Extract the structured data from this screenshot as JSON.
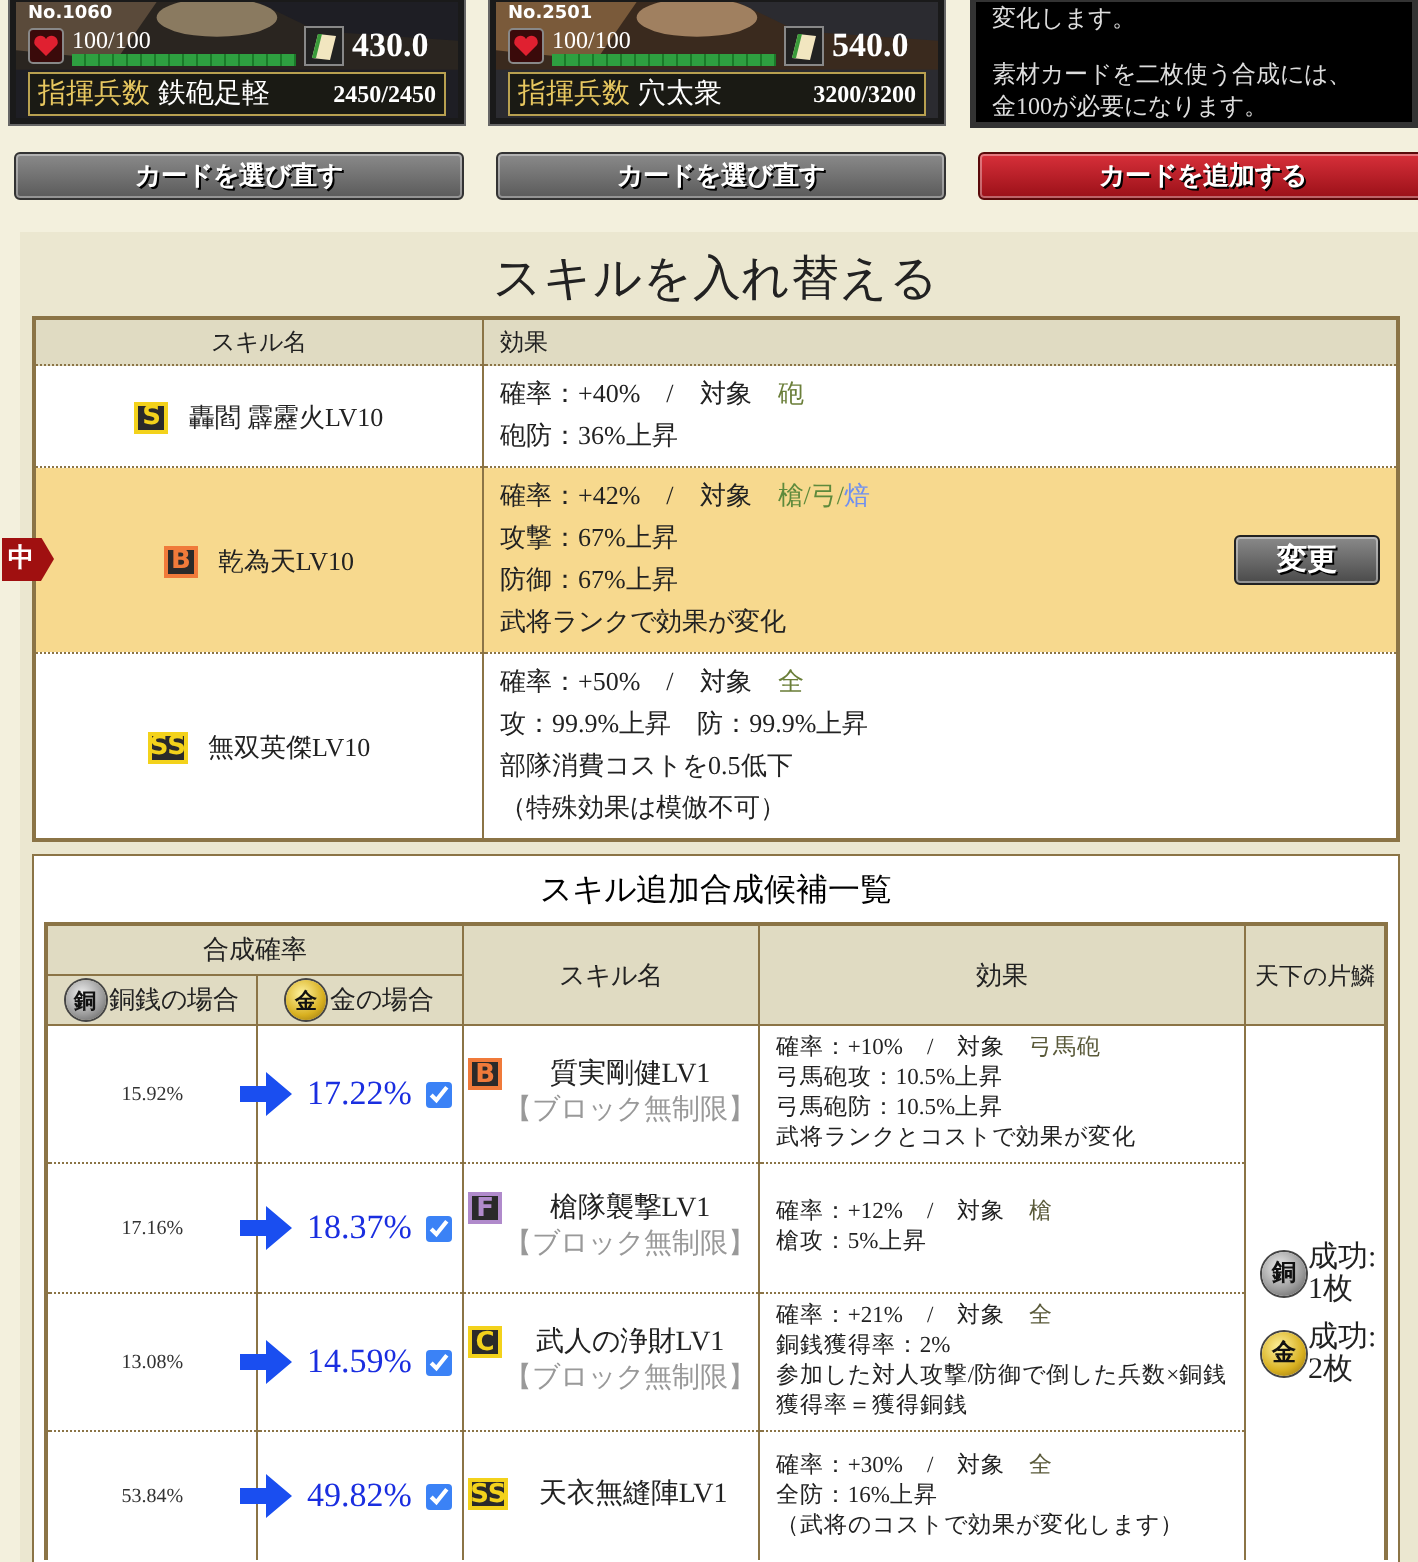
{
  "cards": [
    {
      "number": "No.1060",
      "hp": "100/100",
      "hp_bar": {
        "level": 1
      },
      "cost": "430.0",
      "troop_label": "指揮兵数",
      "troop_type": "鉄砲足軽",
      "troops": "2450/2450"
    },
    {
      "number": "No.2501",
      "hp": "100/100",
      "hp_bar": {
        "level": 1
      },
      "cost": "540.0",
      "troop_label": "指揮兵数",
      "troop_type": "穴太衆",
      "troops": "3200/3200"
    }
  ],
  "info_panel": {
    "lines": [
      "変化します。",
      "素材カードを二枚使う合成には、",
      "金100が必要になります。"
    ]
  },
  "buttons": [
    {
      "label": "カードを選び直す",
      "kind": "grey"
    },
    {
      "label": "カードを選び直す",
      "kind": "grey"
    },
    {
      "label": "カードを追加する",
      "kind": "red"
    }
  ],
  "swap_section": {
    "title": "スキルを入れ替える",
    "columns": [
      "スキル名",
      "効果"
    ],
    "marker": "中",
    "change_button": "変更",
    "rows": [
      {
        "rank": "S",
        "color": "#f3d21b",
        "name": "轟閻 霹靂火LV10",
        "rate": "確率：+40%　/　対象",
        "targets": [
          {
            "text": "砲",
            "color": "#6b7f3a"
          }
        ],
        "effects": [
          "砲防：36%上昇"
        ],
        "selected": false
      },
      {
        "rank": "B",
        "color": "#f07a3a",
        "name": "乾為天LV10",
        "rate": "確率：+42%　/　対象",
        "targets": [
          {
            "text": "槍",
            "color": "#5e8a3c"
          },
          {
            "text": "/",
            "color": "#5e8a3c"
          },
          {
            "text": "弓",
            "color": "#5e8a3c"
          },
          {
            "text": "/",
            "color": "#5e8a3c"
          },
          {
            "text": "焙",
            "color": "#6f8ff0"
          }
        ],
        "effects": [
          "攻撃：67%上昇",
          "防御：67%上昇",
          "武将ランクで効果が変化"
        ],
        "selected": true
      },
      {
        "rank": "SS",
        "color": "#f3d21b",
        "name": "無双英傑LV10",
        "rate": "確率：+50%　/　対象",
        "targets": [
          {
            "text": "全",
            "color": "#6b7f3a"
          }
        ],
        "effects": [
          "攻：99.9%上昇　防：99.9%上昇",
          "部隊消費コストを0.5低下",
          "（特殊効果は模倣不可）"
        ],
        "selected": false
      }
    ]
  },
  "candidate_section": {
    "title": "スキル追加合成候補一覧",
    "rate_group": "合成確率",
    "copper_header": {
      "coin": "銅",
      "label": "銅銭の場合"
    },
    "gold_header": {
      "coin": "金",
      "label": "金の場合"
    },
    "columns": [
      "スキル名",
      "効果",
      "天下の片鱗"
    ],
    "rows": [
      {
        "copper_rate": "15.92%",
        "gold_rate": "17.22%",
        "checked": true,
        "rank": "B",
        "color": "#f07a3a",
        "name": "質実剛健LV1",
        "note": "【ブロック無制限】",
        "rate": "確率：+10%　/　対象",
        "targets": [
          {
            "text": "弓馬砲",
            "color": "#5a5a3a"
          }
        ],
        "effects": [
          "弓馬砲攻：10.5%上昇",
          "弓馬砲防：10.5%上昇",
          "武将ランクとコストで効果が変化"
        ]
      },
      {
        "copper_rate": "17.16%",
        "gold_rate": "18.37%",
        "checked": true,
        "rank": "F",
        "color": "#b08acb",
        "name": "槍隊襲撃LV1",
        "note": "【ブロック無制限】",
        "rate": "確率：+12%　/　対象",
        "targets": [
          {
            "text": "槍",
            "color": "#5a5a3a"
          }
        ],
        "effects": [
          "槍攻：5%上昇"
        ]
      },
      {
        "copper_rate": "13.08%",
        "gold_rate": "14.59%",
        "checked": true,
        "rank": "C",
        "color": "#f3d21b",
        "name": "武人の浄財LV1",
        "note": "【ブロック無制限】",
        "rate": "確率：+21%　/　対象",
        "targets": [
          {
            "text": "全",
            "color": "#5a5a3a"
          }
        ],
        "effects": [
          "銅銭獲得率：2%",
          "参加した対人攻撃/防御で倒した兵数×銅銭獲得率＝獲得銅銭"
        ]
      },
      {
        "copper_rate": "53.84%",
        "gold_rate": "49.82%",
        "checked": true,
        "rank": "SS",
        "color": "#f3d21b",
        "name": "天衣無縫陣LV1",
        "rate": "確率：+30%　/　対象",
        "targets": [
          {
            "text": "全",
            "color": "#5a5a3a"
          }
        ],
        "effects": [
          "全防：16%上昇",
          "（武将のコストで効果が変化します）"
        ]
      }
    ],
    "rewards": [
      {
        "kind": "copper",
        "coin": "銅",
        "text": "成功:1枚"
      },
      {
        "kind": "gold",
        "coin": "金",
        "text": "成功:2枚"
      }
    ]
  }
}
